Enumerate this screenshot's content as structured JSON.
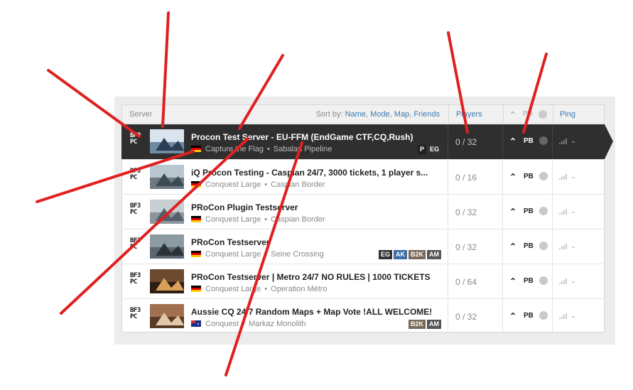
{
  "header": {
    "server_label": "Server",
    "sort_by_label": "Sort by:",
    "sort_options": [
      "Name",
      "Mode",
      "Map",
      "Friends"
    ],
    "players_label": "Players",
    "pb_label": "PB",
    "ping_label": "Ping"
  },
  "rows": [
    {
      "platform": "BF3 PC",
      "name": "Procon Test Server - EU-FFM (EndGame CTF,CQ,Rush)",
      "mode": "Capture the Flag",
      "map": "Sabalan Pipeline",
      "players": "0 / 32",
      "pb": "PB",
      "ping": "-",
      "flag": "de",
      "badges": [
        "P",
        "EG"
      ],
      "selected": true
    },
    {
      "platform": "BF3 PC",
      "name": "iQ Procon Testing - Caspian 24/7, 3000 tickets, 1 player s...",
      "mode": "Conquest Large",
      "map": "Caspian Border",
      "players": "0 / 16",
      "pb": "PB",
      "ping": "-",
      "flag": "de",
      "badges": []
    },
    {
      "platform": "BF3 PC",
      "name": "PRoCon Plugin Testserver",
      "mode": "Conquest Large",
      "map": "Caspian Border",
      "players": "0 / 32",
      "pb": "PB",
      "ping": "-",
      "flag": "de",
      "badges": []
    },
    {
      "platform": "BF3 PC",
      "name": "PRoCon Testserver",
      "mode": "Conquest Large",
      "map": "Seine Crossing",
      "players": "0 / 32",
      "pb": "PB",
      "ping": "-",
      "flag": "de",
      "badges": [
        "EG",
        "AK",
        "B2K",
        "AM"
      ]
    },
    {
      "platform": "BF3 PC",
      "name": "PRoCon Testserver | Metro 24/7 NO RULES | 1000 TICKETS",
      "mode": "Conquest Large",
      "map": "Operation Métro",
      "players": "0 / 64",
      "pb": "PB",
      "ping": "-",
      "flag": "de",
      "badges": []
    },
    {
      "platform": "BF3 PC",
      "name": "Aussie CQ 24/7 Random Maps + Map Vote !ALL WELCOME!",
      "mode": "Conquest",
      "map": "Markaz Monolith",
      "players": "0 / 32",
      "pb": "PB",
      "ping": "-",
      "flag": "au",
      "badges": [
        "B2K",
        "AM"
      ]
    }
  ],
  "colors": {
    "accent": "#3b7bb3",
    "selected_row": "#2f2f2f",
    "annotation": "#e02020",
    "badge_EG": "#333333",
    "badge_AK": "#3a6ea5",
    "badge_B2K": "#7a6a5a",
    "badge_AM": "#555555",
    "badge_P": "#222222"
  },
  "icons": {
    "rank": "chevron-up-icon",
    "punkbuster": "pb-icon",
    "hardcore": "skull-icon",
    "ping": "signal-bars-icon"
  }
}
